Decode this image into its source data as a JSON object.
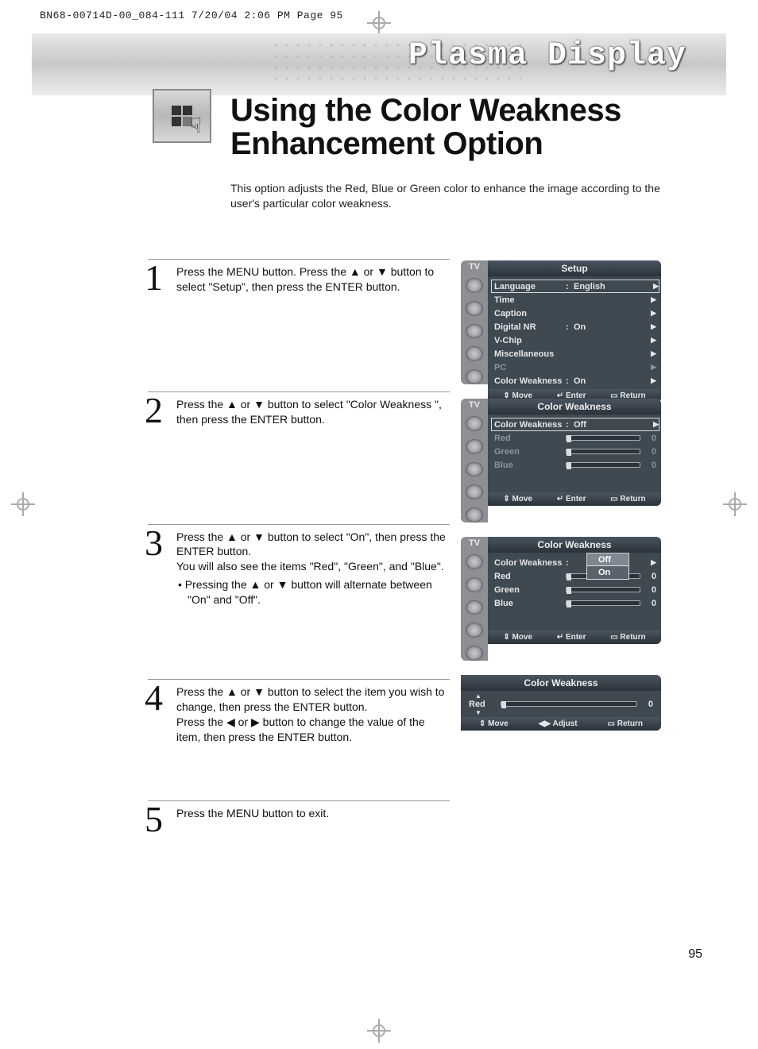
{
  "print_header": "BN68-00714D-00_084-111  7/20/04  2:06 PM  Page 95",
  "doc_title": "Plasma Display",
  "heading": "Using the Color Weakness Enhancement Option",
  "intro": "This option adjusts the Red, Blue or Green color to enhance the image according to the user's particular color weakness.",
  "steps": [
    {
      "num": "1",
      "text": "Press the MENU button. Press the ▲ or ▼ button to select \"Setup\", then press the ENTER button."
    },
    {
      "num": "2",
      "text": "Press the ▲ or ▼ button to select \"Color Weakness \", then press the ENTER button."
    },
    {
      "num": "3",
      "text": "Press the ▲ or ▼ button to select \"On\", then press the ENTER button.",
      "extra1": "You will also see the items \"Red\", \"Green\", and \"Blue\".",
      "bullet": "• Pressing the ▲ or ▼ button will alternate between \"On\" and \"Off\"."
    },
    {
      "num": "4",
      "text": "Press the ▲ or ▼ button to select the item you wish to change, then press the ENTER button.",
      "extra1": "Press the ◀ or ▶ button to change the value of the item, then press the ENTER button."
    },
    {
      "num": "5",
      "text": "Press the MENU button to exit."
    }
  ],
  "page_num": "95",
  "osd1": {
    "tv": "TV",
    "title": "Setup",
    "rows": [
      {
        "label": "Language",
        "val": "English",
        "sel": true
      },
      {
        "label": "Time"
      },
      {
        "label": "Caption"
      },
      {
        "label": "Digital NR",
        "val": "On"
      },
      {
        "label": "V-Chip"
      },
      {
        "label": "Miscellaneous"
      },
      {
        "label": "PC",
        "dim": true
      },
      {
        "label": "Color Weakness",
        "val": "On"
      }
    ],
    "foot": {
      "a": "Move",
      "b": "Enter",
      "c": "Return",
      "ai": "⇕",
      "bi": "↵",
      "ci": "▭"
    }
  },
  "osd2": {
    "tv": "TV",
    "title": "Color Weakness",
    "rows": [
      {
        "label": "Color Weakness",
        "val": "Off",
        "sel": true
      },
      {
        "label": "Red",
        "slider": true,
        "sv": "0",
        "dim": true
      },
      {
        "label": "Green",
        "slider": true,
        "sv": "0",
        "dim": true
      },
      {
        "label": "Blue",
        "slider": true,
        "sv": "0",
        "dim": true
      }
    ],
    "foot": {
      "a": "Move",
      "b": "Enter",
      "c": "Return",
      "ai": "⇕",
      "bi": "↵",
      "ci": "▭"
    }
  },
  "osd3": {
    "tv": "TV",
    "title": "Color Weakness",
    "rows": [
      {
        "label": "Color Weakness",
        "colon_only": true
      },
      {
        "label": "Red",
        "slider": true,
        "sv": "0"
      },
      {
        "label": "Green",
        "slider": true,
        "sv": "0"
      },
      {
        "label": "Blue",
        "slider": true,
        "sv": "0"
      }
    ],
    "dropdown": {
      "opt1": "Off",
      "opt2": "On"
    },
    "foot": {
      "a": "Move",
      "b": "Enter",
      "c": "Return",
      "ai": "⇕",
      "bi": "↵",
      "ci": "▭"
    }
  },
  "osd4": {
    "title": "Color Weakness",
    "label": "Red",
    "sv": "0",
    "foot": {
      "a": "Move",
      "b": "Adjust",
      "c": "Return",
      "ai": "⇕",
      "bi": "◀▶",
      "ci": "▭"
    }
  }
}
